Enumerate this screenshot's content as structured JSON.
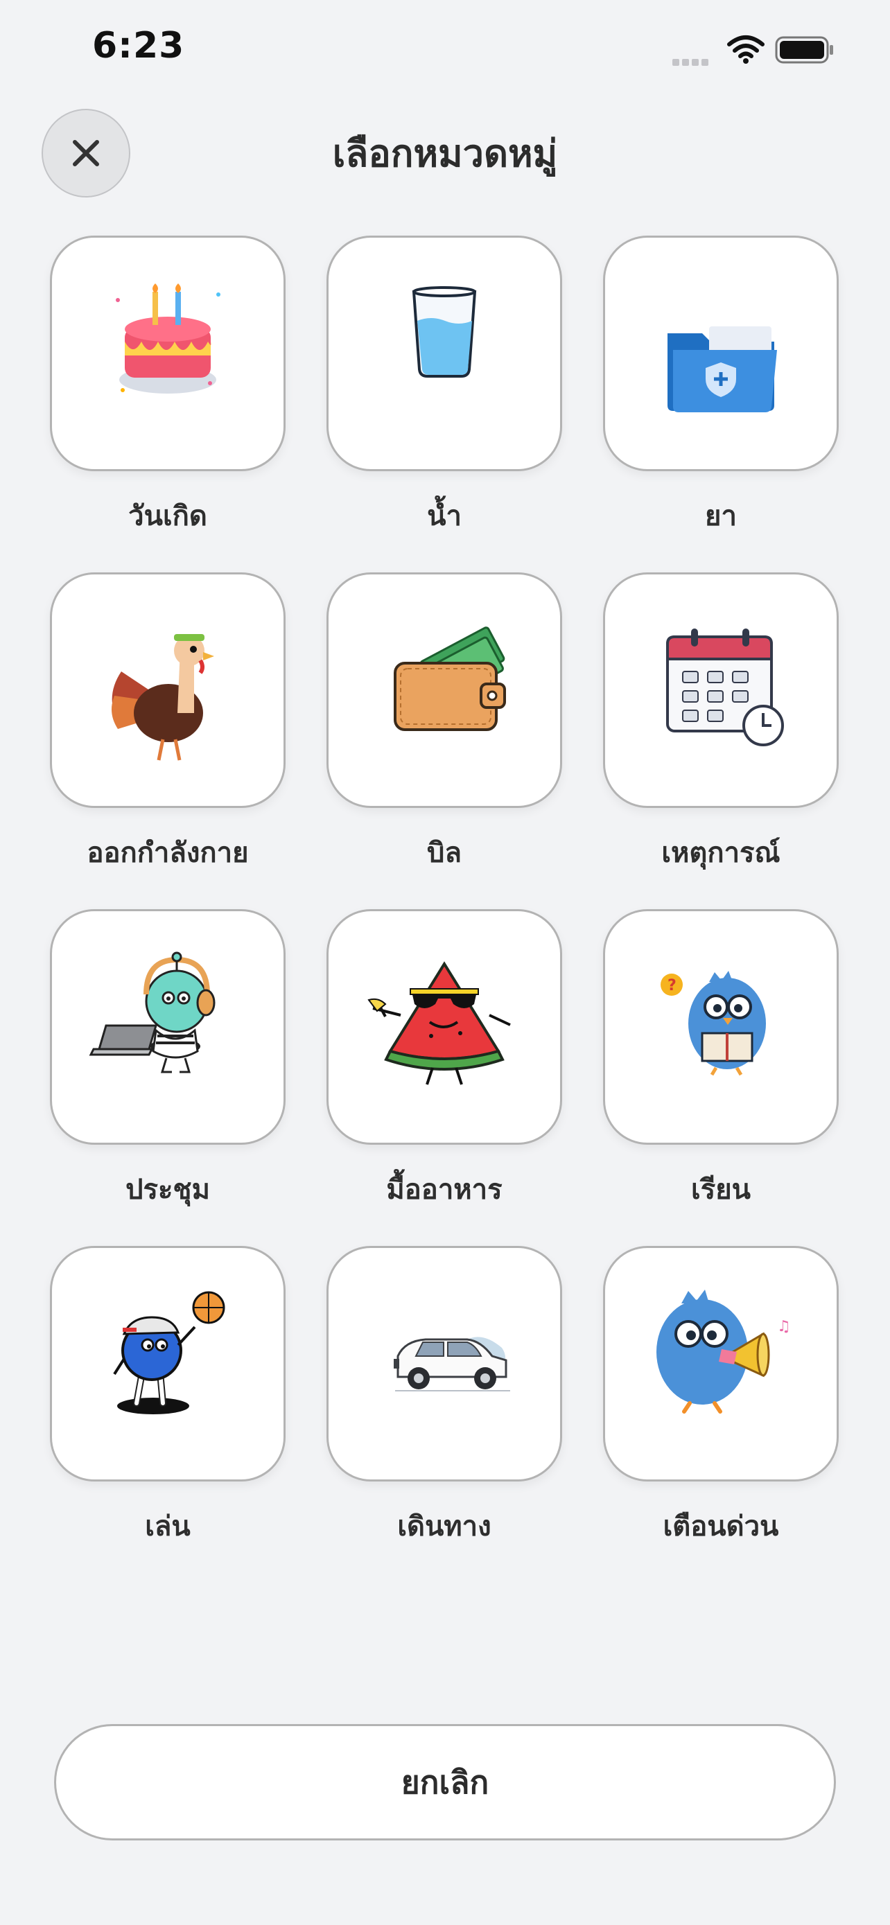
{
  "status_bar": {
    "time": "6:23",
    "icons": [
      "cellular-signal-icon",
      "wifi-icon",
      "battery-icon"
    ]
  },
  "header": {
    "title": "เลือกหมวดหมู่",
    "close_icon": "close-icon"
  },
  "categories": [
    {
      "label": "วันเกิด",
      "icon": "birthday-cake-icon"
    },
    {
      "label": "น้ำ",
      "icon": "water-glass-icon"
    },
    {
      "label": "ยา",
      "icon": "medical-folder-icon"
    },
    {
      "label": "ออกกำลังกาย",
      "icon": "turkey-exercise-icon"
    },
    {
      "label": "บิล",
      "icon": "wallet-icon"
    },
    {
      "label": "เหตุการณ์",
      "icon": "calendar-clock-icon"
    },
    {
      "label": "ประชุม",
      "icon": "laptop-character-icon"
    },
    {
      "label": "มื้ออาหาร",
      "icon": "watermelon-icon"
    },
    {
      "label": "เรียน",
      "icon": "reading-bird-icon"
    },
    {
      "label": "เล่น",
      "icon": "basketball-character-icon"
    },
    {
      "label": "เดินทาง",
      "icon": "car-icon"
    },
    {
      "label": "เตือนด่วน",
      "icon": "megaphone-bird-icon"
    }
  ],
  "footer": {
    "cancel_label": "ยกเลิก"
  },
  "colors": {
    "background": "#f2f3f5",
    "tile_border": "#b3b3b3",
    "text": "#2c2c2c"
  }
}
